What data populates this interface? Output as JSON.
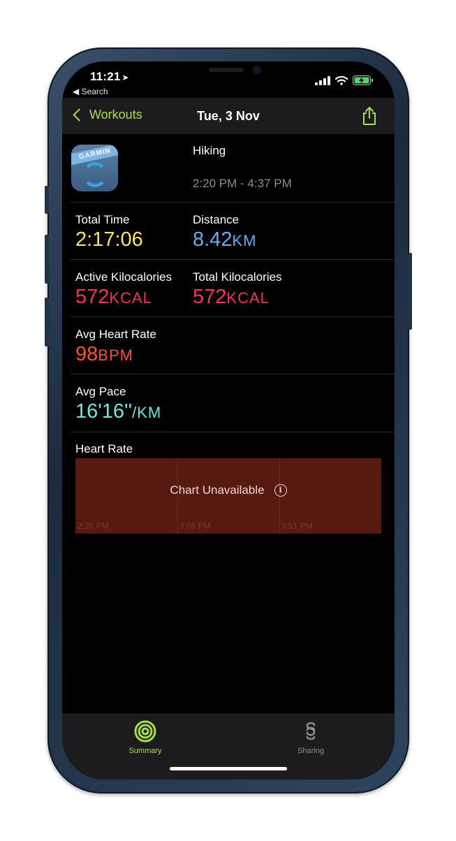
{
  "status_bar": {
    "time": "11:21",
    "back_label": "Search"
  },
  "nav": {
    "back_label": "Workouts",
    "title": "Tue, 3 Nov"
  },
  "workout": {
    "app_icon_text": "GARMIN",
    "activity": "Hiking",
    "time_range": "2:20 PM - 4:37 PM"
  },
  "metrics": {
    "total_time": {
      "label": "Total Time",
      "value": "2:17:06",
      "color": "#ffe066"
    },
    "distance": {
      "label": "Distance",
      "value": "8.42",
      "unit": "KM",
      "color": "#5fb2f2"
    },
    "active_kcal": {
      "label": "Active Kilocalories",
      "value": "572",
      "unit": "KCAL",
      "color": "#f5325b"
    },
    "total_kcal": {
      "label": "Total Kilocalories",
      "value": "572",
      "unit": "KCAL",
      "color": "#f5325b"
    },
    "avg_hr": {
      "label": "Avg Heart Rate",
      "value": "98",
      "unit": "BPM",
      "color": "#ff4c3b"
    },
    "avg_pace": {
      "label": "Avg Pace",
      "value": "16'16''",
      "unit": "/KM",
      "color": "#6ee7e0"
    }
  },
  "heart_rate_chart": {
    "title": "Heart Rate",
    "message": "Chart Unavailable",
    "ticks": [
      "2:20 PM",
      "3:06 PM",
      "3:51 PM"
    ]
  },
  "tabbar": {
    "tabs": [
      {
        "label": "Summary",
        "active": true,
        "color": "#a6e14b"
      },
      {
        "label": "Sharing",
        "active": false,
        "color": "#8e8e93"
      }
    ]
  }
}
